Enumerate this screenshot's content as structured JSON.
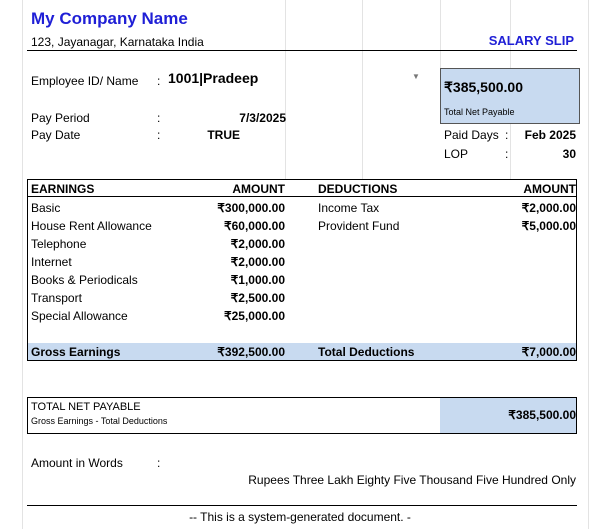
{
  "header": {
    "company_name": "My Company Name",
    "address": "123, Jayanagar, Karnataka India",
    "slip_title": "SALARY SLIP"
  },
  "employee": {
    "id_label": "Employee ID/ Name",
    "sep": ":",
    "id_value": "1001|Pradeep",
    "pay_period_label": "Pay Period",
    "pay_period_value": "7/3/2025",
    "pay_date_label": "Pay Date",
    "pay_date_value": "TRUE"
  },
  "net_box": {
    "amount": "₹385,500.00",
    "label": "Total Net Payable"
  },
  "attendance": {
    "paid_days_label": "Paid Days",
    "paid_days_value": "Feb 2025",
    "lop_label": "LOP",
    "lop_value": "30"
  },
  "earnings": {
    "header": "EARNINGS",
    "amount_header": "AMOUNT",
    "rows": [
      {
        "name": "Basic",
        "amount": "₹300,000.00"
      },
      {
        "name": "House Rent Allowance",
        "amount": "₹60,000.00"
      },
      {
        "name": "Telephone",
        "amount": "₹2,000.00"
      },
      {
        "name": "Internet",
        "amount": "₹2,000.00"
      },
      {
        "name": "Books & Periodicals",
        "amount": "₹1,000.00"
      },
      {
        "name": "Transport",
        "amount": "₹2,500.00"
      },
      {
        "name": "Special Allowance",
        "amount": "₹25,000.00"
      }
    ],
    "total_label": "Gross Earnings",
    "total_amount": "₹392,500.00"
  },
  "deductions": {
    "header": "DEDUCTIONS",
    "amount_header": "AMOUNT",
    "rows": [
      {
        "name": "Income Tax",
        "amount": "₹2,000.00"
      },
      {
        "name": "Provident Fund",
        "amount": "₹5,000.00"
      }
    ],
    "total_label": "Total Deductions",
    "total_amount": "₹7,000.00"
  },
  "total_net": {
    "label": "TOTAL NET PAYABLE",
    "sublabel": "Gross Earnings - Total Deductions",
    "amount": "₹385,500.00"
  },
  "words": {
    "label": "Amount in Words",
    "sep": ":",
    "value": "Rupees Three Lakh Eighty Five Thousand Five Hundred Only"
  },
  "footer": "-- This is a system-generated document. -"
}
